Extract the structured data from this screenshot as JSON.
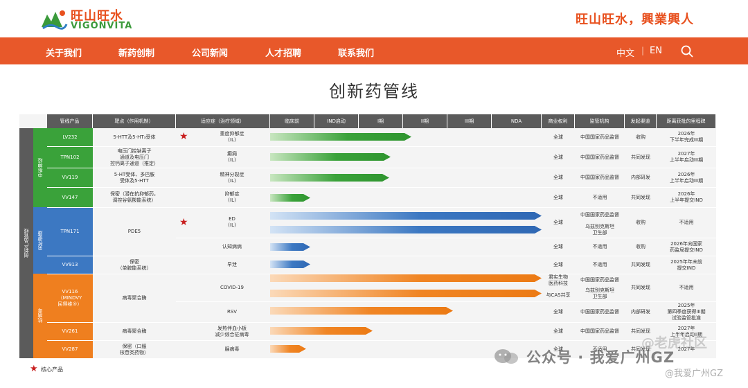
{
  "header": {
    "logo_cn": "旺山旺水",
    "logo_en": "VIGONVITA",
    "slogan": "旺山旺水，興業興人"
  },
  "nav": {
    "items": [
      "关于我们",
      "新药创制",
      "公司新闻",
      "人才招聘",
      "联系我们"
    ],
    "lang_cn": "中文",
    "lang_sep": "|",
    "lang_en": "EN",
    "search_icon": "search-icon"
  },
  "page_title": "创新药管线",
  "table": {
    "headers": [
      "管线产品",
      "靶点（作用机制）",
      "适应症（治疗领域）",
      "临床前",
      "IND启动",
      "I期",
      "II期",
      "III期",
      "NDA",
      "商业权利",
      "监管机构",
      "发起渠道",
      "距离获批的里程碑"
    ],
    "left_group": "创新产品管线",
    "sub_groups": [
      "中枢神经",
      "男性健康",
      "抗病毒"
    ],
    "rows": [
      {
        "product": "LV232",
        "target": "5-HTT及5-HT₃受体",
        "indication": "重度抑郁症\n(IL)",
        "rights": "全球",
        "regulator": "中国国家药品监督",
        "channel": "收购",
        "milestone": "2026年\n下半年完成III期"
      },
      {
        "product": "TPN102",
        "target": "电压门控钠离子\n通道及电压门\n控钙离子通道（推定）",
        "indication": "癫痫\n(IL)",
        "rights": "全球",
        "regulator": "中国国家药品监督",
        "channel": "共同发现",
        "milestone": "2027年\n上半年启动III期"
      },
      {
        "product": "VV119",
        "target": "5-HT受体、多巴胺\n受体及5-HTT",
        "indication": "精神分裂症\n(IL)",
        "rights": "全球",
        "regulator": "中国国家药品监督",
        "channel": "内部研发",
        "milestone": "2026年\n上半年启动III期"
      },
      {
        "product": "VV147",
        "target": "保密（潜在抗抑郁药，\n调控谷氨酸能系统）",
        "indication": "抑郁症\n(IL)",
        "rights": "全球",
        "regulator": "不适用",
        "channel": "共同发现",
        "milestone": "2026年\n上半年提交IND"
      },
      {
        "product": "TPN171",
        "target": "PDE5",
        "indication": "ED\n(IL)",
        "rights": "全球",
        "regulator": "中国国家药品监督",
        "regulator2": "乌兹别克斯坦\n卫生部",
        "channel": "收购",
        "milestone": "不适用"
      },
      {
        "product": "",
        "target": "",
        "indication": "认知病病",
        "rights": "全球",
        "regulator": "不适用",
        "channel": "收购",
        "milestone": "2026年向国家\n药监局提交IND"
      },
      {
        "product": "VV913",
        "target": "保密\n（单胺能系统）",
        "indication": "早泄",
        "rights": "全球",
        "regulator": "不适用",
        "channel": "共同发现",
        "milestone": "2025年年末前\n提交IND"
      },
      {
        "product": "VV116\n（MINDVY\n民得维®）",
        "target": "病毒聚合酶",
        "indication": "COVID-19",
        "rights": "君实生物\n医药科技",
        "rights2": "与CAS共享",
        "regulator": "中国国家药品监督",
        "regulator2": "乌兹别克斯坦\n卫生部",
        "channel": "共同发现",
        "milestone": "不适用"
      },
      {
        "product": "",
        "target": "",
        "indication": "RSV",
        "rights": "全球",
        "regulator": "中国国家药品监督",
        "channel": "内部研发",
        "milestone": "2025年\n第四季度获得III期\n试验监管批准"
      },
      {
        "product": "VV261",
        "target": "病毒聚合酶",
        "indication": "发热伴血小板\n减少综合征病毒",
        "rights": "全球",
        "regulator": "中国国家药品监督",
        "channel": "共同发现",
        "milestone": "2027年\n上半年启动II期"
      },
      {
        "product": "VV287",
        "target": "保密（口服\n核苷类药物）",
        "indication": "腺病毒",
        "rights": "全球",
        "regulator": "不适用",
        "channel": "共同发现",
        "milestone": "2027年"
      }
    ]
  },
  "legend": {
    "label": "核心产品"
  },
  "watermarks": {
    "main": "公众号 · 我爱广州GZ",
    "corner": "@老虎社区",
    "small": "@我爱广州GZ"
  }
}
